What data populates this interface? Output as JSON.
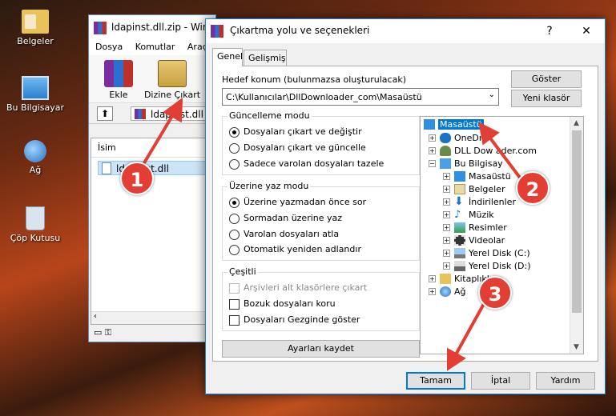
{
  "desktop": {
    "icons": [
      {
        "label": "Belgeler",
        "icon": "folder-icon"
      },
      {
        "label": "Bu Bilgisayar",
        "icon": "computer-icon"
      },
      {
        "label": "Ağ",
        "icon": "network-icon"
      },
      {
        "label": "Çöp Kutusu",
        "icon": "recycle-bin-icon"
      }
    ]
  },
  "archive_window": {
    "title": "ldapinst.dll.zip - Win",
    "menu": [
      "Dosya",
      "Komutlar",
      "Araçla"
    ],
    "toolbar": {
      "add": "Ekle",
      "extract": "Dizine Çıkart"
    },
    "path": "ldapinst.dll",
    "column_name": "İsim",
    "file": "ldapinst.dll"
  },
  "dialog": {
    "title": "Çıkartma yolu ve seçenekleri",
    "help_glyph": "?",
    "close_glyph": "✕",
    "tabs": [
      "Genel",
      "Gelişmiş"
    ],
    "target_label": "Hedef konum (bulunmazsa oluşturulacak)",
    "target_value": "C:\\Kullanıcılar\\DllDownloader_com\\Masaüstü",
    "show_button": "Göster",
    "new_folder_button": "Yeni klasör",
    "update_mode": {
      "title": "Güncelleme modu",
      "options": [
        "Dosyaları çıkart ve değiştir",
        "Dosyaları çıkart ve güncelle",
        "Sadece varolan dosyaları tazele"
      ],
      "selected": 0
    },
    "overwrite_mode": {
      "title": "Üzerine yaz modu",
      "options": [
        "Üzerine yazmadan önce sor",
        "Sormadan üzerine yaz",
        "Varolan dosyaları atla",
        "Otomatik yeniden adlandır"
      ],
      "selected": 0
    },
    "misc": {
      "title": "Çeşitli",
      "options": [
        "Arşivleri alt klasörlere çıkart",
        "Bozuk dosyaları koru",
        "Dosyaları Gezginde göster"
      ]
    },
    "save_settings": "Ayarları kaydet",
    "tree": [
      {
        "label": "Masaüstü",
        "selected": true
      },
      {
        "label": "OneDr"
      },
      {
        "label": "DLL Dow  ader.com"
      },
      {
        "label": "Bu Bilgisay"
      },
      {
        "label": "Masaüstü"
      },
      {
        "label": "Belgeler"
      },
      {
        "label": "İndirilenler"
      },
      {
        "label": "Müzik"
      },
      {
        "label": "Resimler"
      },
      {
        "label": "Videolar"
      },
      {
        "label": "Yerel Disk (C:)"
      },
      {
        "label": "Yerel Disk (D:)"
      },
      {
        "label": "Kitaplıklar"
      },
      {
        "label": "Ağ"
      }
    ],
    "buttons": {
      "ok": "Tamam",
      "cancel": "İptal",
      "help": "Yardım"
    }
  },
  "markers": [
    "1",
    "2",
    "3"
  ],
  "colors": {
    "marker": "#e23e33",
    "selection": "#0078d7"
  }
}
